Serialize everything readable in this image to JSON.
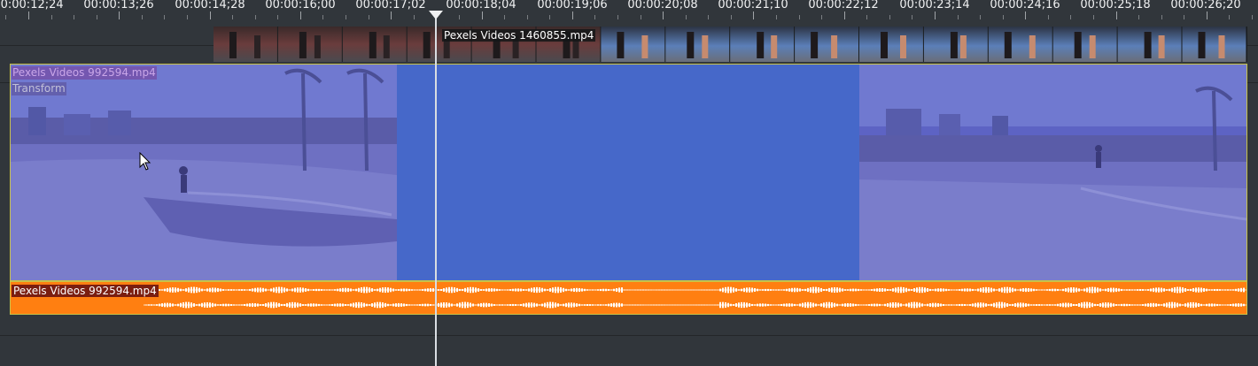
{
  "ruler": {
    "timecodes": [
      "00:00:12;24",
      "00:00:13;26",
      "00:00:14;28",
      "00:00:16;00",
      "00:00:17;02",
      "00:00:18;04",
      "00:00:19;06",
      "00:00:20;08",
      "00:00:21;10",
      "00:00:22;12",
      "00:00:23;14",
      "00:00:24;16",
      "00:00:25;18",
      "00:00:26;20"
    ]
  },
  "tracks": {
    "video_top": {
      "clip_name": "Pexels Videos 1460855.mp4"
    },
    "video_main": {
      "clip_name": "Pexels Videos 992594.mp4",
      "effect_name": "Transform"
    },
    "audio": {
      "clip_name": "Pexels Videos 992594.mp4"
    }
  },
  "colors": {
    "background": "#31363b",
    "video_clip": "#4668c9",
    "audio_clip": "#ff7f11",
    "selection_border": "#c7c24a",
    "playhead": "#eff0f1"
  },
  "icons": {
    "playhead": "playhead-marker-icon",
    "cursor": "mouse-pointer-icon"
  }
}
